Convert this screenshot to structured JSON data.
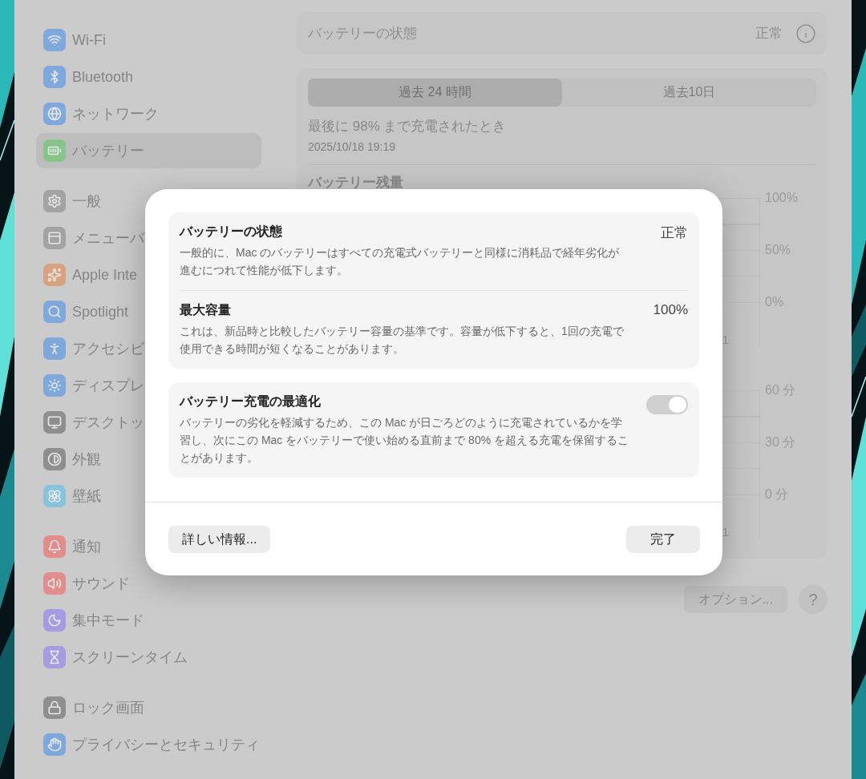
{
  "sidebar": {
    "groups": [
      {
        "items": [
          {
            "label": "Wi-Fi",
            "color": "#7fa8dc",
            "selected": false
          },
          {
            "label": "Bluetooth",
            "color": "#7fa8dc",
            "selected": false
          },
          {
            "label": "ネットワーク",
            "color": "#7fa8dc",
            "selected": false
          },
          {
            "label": "バッテリー",
            "color": "#86c48a",
            "selected": true
          }
        ]
      },
      {
        "items": [
          {
            "label": "一般",
            "color": "#a3a3a3",
            "selected": false
          },
          {
            "label": "メニューバ",
            "color": "#a3a3a3",
            "selected": false
          },
          {
            "label": "Apple Inte",
            "color": "#d9a27f",
            "selected": false
          },
          {
            "label": "Spotlight",
            "color": "#7fa8dc",
            "selected": false
          },
          {
            "label": "アクセシビ",
            "color": "#7fa8dc",
            "selected": false
          },
          {
            "label": "ディスプレ",
            "color": "#7fa8dc",
            "selected": false
          },
          {
            "label": "デスクトッ",
            "color": "#8f8f8f",
            "selected": false
          },
          {
            "label": "外観",
            "color": "#8f8f8f",
            "selected": false
          },
          {
            "label": "壁紙",
            "color": "#88c3dd",
            "selected": false
          }
        ]
      },
      {
        "items": [
          {
            "label": "通知",
            "color": "#e28c8c",
            "selected": false
          },
          {
            "label": "サウンド",
            "color": "#e28c8c",
            "selected": false
          },
          {
            "label": "集中モード",
            "color": "#a49be0",
            "selected": false
          },
          {
            "label": "スクリーンタイム",
            "color": "#a49be0",
            "selected": false
          }
        ]
      },
      {
        "items": [
          {
            "label": "ロック画面",
            "color": "#8f8f8f",
            "selected": false
          },
          {
            "label": "プライバシーとセキュリティ",
            "color": "#7fa8dc",
            "selected": false
          }
        ]
      }
    ]
  },
  "health_row": {
    "label": "バッテリーの状態",
    "value": "正常"
  },
  "history": {
    "tabs": [
      {
        "label": "過去 24 時間",
        "selected": true
      },
      {
        "label": "過去10日",
        "selected": false
      }
    ],
    "last_charged": {
      "title": "最後に 98% まで充電されたとき",
      "time": "2025/10/18 19:19"
    },
    "level_heading": "バッテリー残量",
    "charts": [
      {
        "y_labels": [
          "100%",
          "50%",
          "0%"
        ],
        "x_label": "1"
      },
      {
        "y_labels": [
          "60 分",
          "30 分",
          "0 分"
        ],
        "x_label": "1"
      }
    ]
  },
  "footer": {
    "options_button": "オプション...",
    "help_button": "?"
  },
  "dialog": {
    "cards": [
      {
        "rows": [
          {
            "title": "バッテリーの状態",
            "description": "一般的に、Mac のバッテリーはすべての充電式バッテリーと同様に消耗品で経年劣化が進むにつれて性能が低下します。",
            "value": "正常",
            "kind": "value"
          },
          {
            "title": "最大容量",
            "description": "これは、新品時と比較したバッテリー容量の基準です。容量が低下すると、1回の充電で使用できる時間が短くなることがあります。",
            "value": "100%",
            "kind": "value"
          }
        ]
      },
      {
        "rows": [
          {
            "title": "バッテリー充電の最適化",
            "description": "バッテリーの劣化を軽減するため、この Mac が日ごろどのように充電されているかを学習し、次にこの Mac をバッテリーで使い始める直前まで 80% を超える充電を保留することがあります。",
            "kind": "toggle",
            "on": true,
            "disabled": true
          }
        ]
      }
    ],
    "buttons": {
      "more_info": "詳しい情報...",
      "done": "完了"
    }
  }
}
